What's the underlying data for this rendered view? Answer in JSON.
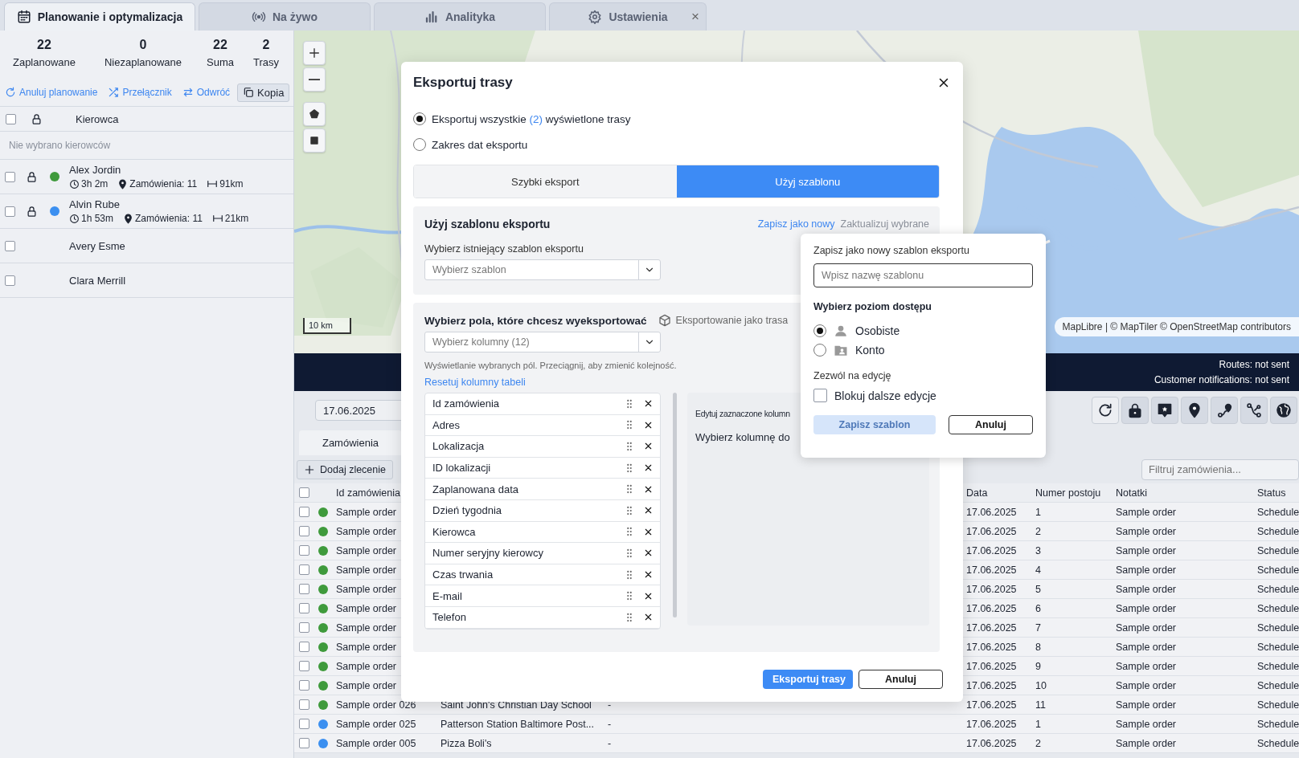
{
  "tabs": [
    {
      "label": "Planowanie i optymalizacja",
      "selected": true
    },
    {
      "label": "Na żywo",
      "selected": false
    },
    {
      "label": "Analityka",
      "selected": false
    },
    {
      "label": "Ustawienia",
      "selected": false,
      "close": "×"
    }
  ],
  "planning": {
    "stats": [
      {
        "value": "22",
        "label": "Zaplanowane"
      },
      {
        "value": "0",
        "label": "Niezaplanowane"
      },
      {
        "value": "22",
        "label": "Suma"
      },
      {
        "value": "2",
        "label": "Trasy"
      }
    ],
    "actions": [
      {
        "label": "Anuluj planowanie",
        "kind": "link"
      },
      {
        "label": "Przełącznik",
        "kind": "link"
      },
      {
        "label": "Odwróć",
        "kind": "link"
      },
      {
        "label": "Kopia",
        "kind": "button"
      }
    ],
    "header": {
      "checked": false,
      "column": "Kierowca"
    },
    "empty_note": "Nie wybrano kierowców",
    "drivers": [
      {
        "name": "Alex Jordin",
        "checked": false,
        "color": "#3f9a3c",
        "duration": "3h 2m",
        "orders": "Zamówienia: 11",
        "distance": "91km"
      },
      {
        "name": "Alvin Rube",
        "checked": false,
        "color": "#3b8ff0",
        "duration": "1h 53m",
        "orders": "Zamówienia: 11",
        "distance": "21km"
      },
      {
        "name": "Avery Esme",
        "checked": false
      },
      {
        "name": "Clara Merrill",
        "checked": false
      }
    ]
  },
  "map": {
    "scale": "10 km",
    "attribution": "MapLibre | © MapTiler © OpenStreetMap contributors"
  },
  "status_bar": {
    "lines": [
      "Routes: not sent",
      "Customer notifications: not sent"
    ]
  },
  "orders": {
    "date": "17.06.2025",
    "tabs": [
      {
        "label": "Zamówienia",
        "selected": true
      }
    ],
    "add_button": "Dodaj zlecenie",
    "filter_placeholder": "Filtruj zamówienia...",
    "header_checked": false,
    "columns": {
      "id": "Id zamówienia",
      "date": "Data",
      "stop": "Numer postoju",
      "notes": "Notatki",
      "status": "Status"
    },
    "rows": [
      {
        "checked": false,
        "color": "#3f9a3c",
        "id": "Sample order",
        "date": "17.06.2025",
        "stop": "1",
        "notes": "Sample order",
        "status": "Schedule"
      },
      {
        "checked": false,
        "color": "#3f9a3c",
        "id": "Sample order",
        "date": "17.06.2025",
        "stop": "2",
        "notes": "Sample order",
        "status": "Schedule"
      },
      {
        "checked": false,
        "color": "#3f9a3c",
        "id": "Sample order",
        "date": "17.06.2025",
        "stop": "3",
        "notes": "Sample order",
        "status": "Schedule"
      },
      {
        "checked": false,
        "color": "#3f9a3c",
        "id": "Sample order",
        "date": "17.06.2025",
        "stop": "4",
        "notes": "Sample order",
        "status": "Schedule"
      },
      {
        "checked": false,
        "color": "#3f9a3c",
        "id": "Sample order",
        "date": "17.06.2025",
        "stop": "5",
        "notes": "Sample order",
        "status": "Schedule"
      },
      {
        "checked": false,
        "color": "#3f9a3c",
        "id": "Sample order",
        "date": "17.06.2025",
        "stop": "6",
        "notes": "Sample order",
        "status": "Schedule"
      },
      {
        "checked": false,
        "color": "#3f9a3c",
        "id": "Sample order",
        "date": "17.06.2025",
        "stop": "7",
        "notes": "Sample order",
        "status": "Schedule"
      },
      {
        "checked": false,
        "color": "#3f9a3c",
        "id": "Sample order",
        "date": "17.06.2025",
        "stop": "8",
        "notes": "Sample order",
        "status": "Schedule"
      },
      {
        "checked": false,
        "color": "#3f9a3c",
        "id": "Sample order",
        "date": "17.06.2025",
        "stop": "9",
        "notes": "Sample order",
        "status": "Schedule"
      },
      {
        "checked": false,
        "color": "#3f9a3c",
        "id": "Sample order",
        "date": "17.06.2025",
        "stop": "10",
        "notes": "Sample order",
        "status": "Schedule"
      },
      {
        "checked": false,
        "color": "#3f9a3c",
        "id": "Sample order 026",
        "address": "Saint John's Christian Day School",
        "extra": "-",
        "date": "17.06.2025",
        "stop": "11",
        "notes": "Sample order",
        "status": "Schedule"
      },
      {
        "checked": false,
        "color": "#3b8ff0",
        "id": "Sample order 025",
        "address": "Patterson Station Baltimore Post...",
        "extra": "-",
        "date": "17.06.2025",
        "stop": "1",
        "notes": "Sample order",
        "status": "Schedule"
      },
      {
        "checked": false,
        "color": "#3b8ff0",
        "id": "Sample order 005",
        "address": "Pizza Boli's",
        "extra": "-",
        "date": "17.06.2025",
        "stop": "2",
        "notes": "Sample order",
        "status": "Schedule"
      }
    ]
  },
  "export_dialog": {
    "title": "Eksportuj trasy",
    "scope_options": [
      {
        "label": "Eksportuj wszystkie",
        "count": "(2)",
        "suffix": "wyświetlone trasy",
        "selected": true
      },
      {
        "label": "Zakres dat eksportu",
        "selected": false
      }
    ],
    "modes": [
      {
        "label": "Szybki eksport",
        "selected": false
      },
      {
        "label": "Użyj szablonu",
        "selected": true
      }
    ],
    "template_section": {
      "title": "Użyj szablonu eksportu",
      "links": [
        {
          "label": "Zapisz jako nowy",
          "disabled": false
        },
        {
          "label": "Zaktualizuj wybrane",
          "disabled": true
        }
      ],
      "select_label": "Wybierz istniejący szablon eksportu",
      "select_placeholder": "Wybierz szablon"
    },
    "fields_section": {
      "title": "Wybierz pola, które chcesz wyeksportować",
      "export_as": "Eksportowanie jako trasa",
      "select_placeholder": "Wybierz kolumny (12)",
      "hint": "Wyświetlanie wybranych pól. Przeciągnij, aby zmienić kolejność.",
      "reset_link": "Resetuj kolumny tabeli",
      "columns": [
        "Id zamówienia",
        "Adres",
        "Lokalizacja",
        "ID lokalizacji",
        "Zaplanowana data",
        "Dzień tygodnia",
        "Kierowca",
        "Numer seryjny kierowcy",
        "Czas trwania",
        "E-mail",
        "Telefon"
      ],
      "edit_title": "Edytuj zaznaczone kolumn",
      "edit_hint": "Wybierz kolumnę do"
    },
    "buttons": [
      {
        "label": "Eksportuj trasy",
        "kind": "primary",
        "disabled": false
      },
      {
        "label": "Anuluj",
        "kind": "secondary"
      }
    ]
  },
  "save_popover": {
    "title": "Zapisz jako nowy szablon eksportu",
    "name_placeholder": "Wpisz nazwę szablonu",
    "access_title": "Wybierz poziom dostępu",
    "access_options": [
      {
        "label": "Osobiste",
        "selected": true
      },
      {
        "label": "Konto",
        "selected": false
      }
    ],
    "edit_title": "Zezwól na edycję",
    "lock_option": {
      "label": "Blokuj dalsze edycje",
      "checked": false
    },
    "buttons": [
      {
        "label": "Zapisz szablon",
        "kind": "primary",
        "disabled": true
      },
      {
        "label": "Anuluj",
        "kind": "secondary"
      }
    ]
  }
}
